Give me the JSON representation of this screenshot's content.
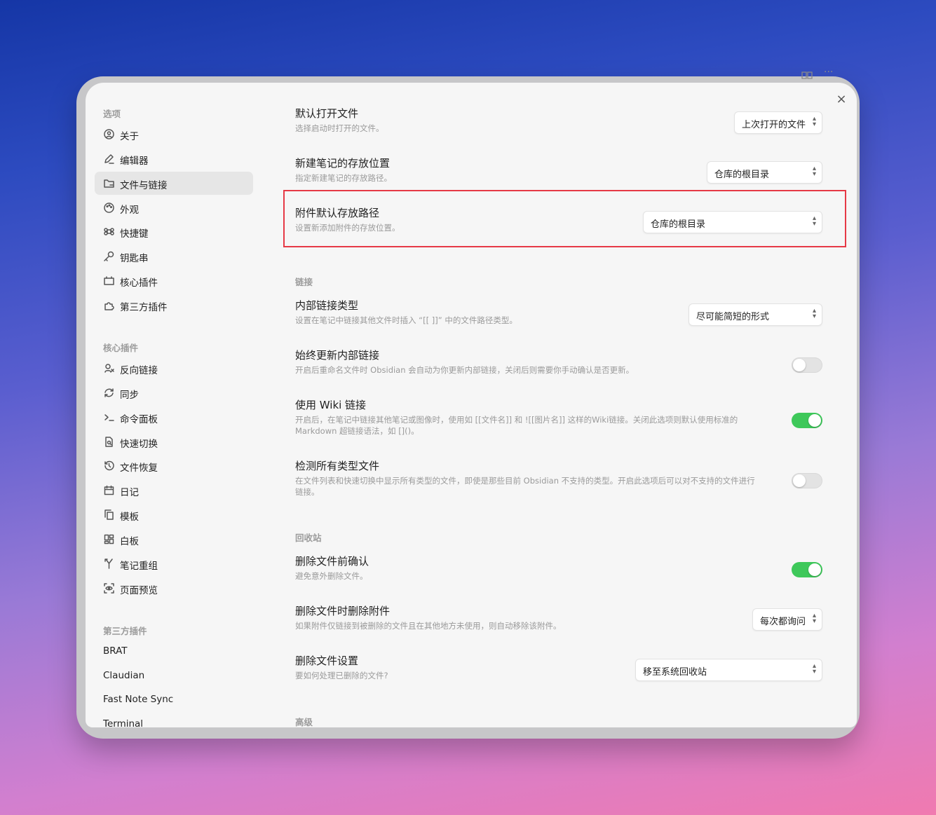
{
  "window": {
    "close_glyph": "×",
    "top_icons": [
      "book-icon",
      "more-icon"
    ]
  },
  "sidebar": {
    "sections": [
      {
        "title": "选项",
        "items": [
          {
            "label": "关于",
            "icon": "info-icon"
          },
          {
            "label": "编辑器",
            "icon": "pencil-icon"
          },
          {
            "label": "文件与链接",
            "icon": "folder-link-icon",
            "active": true
          },
          {
            "label": "外观",
            "icon": "palette-icon"
          },
          {
            "label": "快捷键",
            "icon": "command-icon"
          },
          {
            "label": "钥匙串",
            "icon": "key-icon"
          },
          {
            "label": "核心插件",
            "icon": "plugin-icon"
          },
          {
            "label": "第三方插件",
            "icon": "puzzle-icon"
          }
        ]
      },
      {
        "title": "核心插件",
        "items": [
          {
            "label": "反向链接",
            "icon": "backlink-icon"
          },
          {
            "label": "同步",
            "icon": "sync-icon"
          },
          {
            "label": "命令面板",
            "icon": "terminal-icon"
          },
          {
            "label": "快速切换",
            "icon": "file-search-icon"
          },
          {
            "label": "文件恢复",
            "icon": "history-icon"
          },
          {
            "label": "日记",
            "icon": "calendar-icon"
          },
          {
            "label": "模板",
            "icon": "copy-icon"
          },
          {
            "label": "白板",
            "icon": "canvas-icon"
          },
          {
            "label": "笔记重组",
            "icon": "merge-icon"
          },
          {
            "label": "页面预览",
            "icon": "preview-icon"
          }
        ]
      },
      {
        "title": "第三方插件",
        "items": [
          {
            "label": "BRAT"
          },
          {
            "label": "Claudian"
          },
          {
            "label": "Fast Note Sync"
          },
          {
            "label": "Terminal"
          }
        ]
      }
    ]
  },
  "settings": {
    "default_open": {
      "name": "默认打开文件",
      "desc": "选择启动时打开的文件。",
      "value": "上次打开的文件"
    },
    "new_note_location": {
      "name": "新建笔记的存放位置",
      "desc": "指定新建笔记的存放路径。",
      "value": "仓库的根目录"
    },
    "attachment_path": {
      "name": "附件默认存放路径",
      "desc": "设置新添加附件的存放位置。",
      "value": "仓库的根目录"
    },
    "links_title": "链接",
    "link_format": {
      "name": "内部链接类型",
      "desc": "设置在笔记中链接其他文件时插入 “[[ ]]” 中的文件路径类型。",
      "value": "尽可能简短的形式"
    },
    "auto_update_links": {
      "name": "始终更新内部链接",
      "desc": "开启后重命名文件时 Obsidian 会自动为你更新内部链接，关闭后则需要你手动确认是否更新。",
      "on": false
    },
    "wiki_links": {
      "name": "使用 Wiki 链接",
      "desc1": "开启后，在笔记中链接其他笔记或图像时，使用如 [[文件名]] 和 ![[图片名]] 这样的Wiki链接。关闭此选项则默认使用标准的",
      "desc2": "Markdown 超链接语法，如 []()。",
      "on": true
    },
    "detect_all_types": {
      "name": "检测所有类型文件",
      "desc1": "在文件列表和快速切换中显示所有类型的文件，即使是那些目前 Obsidian 不支持的类型。开启此选项后可以对不支持的文件进行",
      "desc2": "链接。",
      "on": false
    },
    "trash_title": "回收站",
    "confirm_delete": {
      "name": "删除文件前确认",
      "desc": "避免意外删除文件。",
      "on": true
    },
    "delete_attachments": {
      "name": "删除文件时删除附件",
      "desc": "如果附件仅链接到被删除的文件且在其他地方未使用，则自动移除该附件。",
      "value": "每次都询问"
    },
    "delete_option": {
      "name": "删除文件设置",
      "desc": "要如何处理已删除的文件?",
      "value": "移至系统回收站"
    },
    "advanced_title": "高级"
  },
  "colors": {
    "highlight": "#e63946",
    "toggle_on": "#3ec85a"
  }
}
